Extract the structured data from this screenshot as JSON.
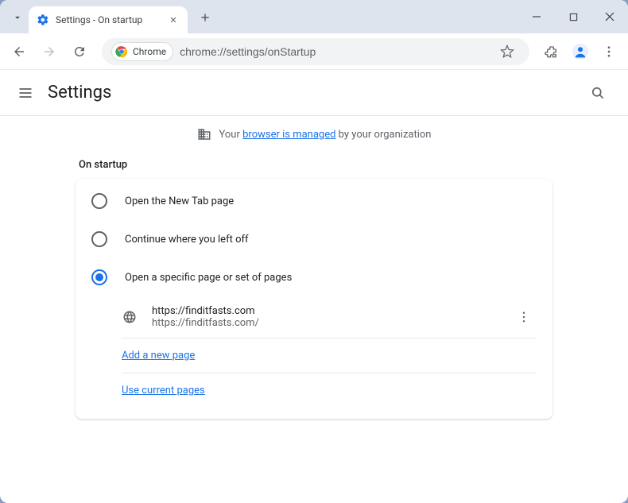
{
  "window": {
    "tab_title": "Settings - On startup",
    "minimize": "–",
    "maximize": "□",
    "close": "✕"
  },
  "toolbar": {
    "chip_label": "Chrome",
    "url": "chrome://settings/onStartup"
  },
  "header": {
    "title": "Settings"
  },
  "managed": {
    "prefix": "Your ",
    "link": "browser is managed",
    "suffix": " by your organization"
  },
  "section": {
    "label": "On startup",
    "options": [
      {
        "label": "Open the New Tab page",
        "selected": false
      },
      {
        "label": "Continue where you left off",
        "selected": false
      },
      {
        "label": "Open a specific page or set of pages",
        "selected": true
      }
    ],
    "startup_page": {
      "title": "https://finditfasts.com",
      "url": "https://finditfasts.com/"
    },
    "add_new_page": "Add a new page",
    "use_current": "Use current pages"
  }
}
